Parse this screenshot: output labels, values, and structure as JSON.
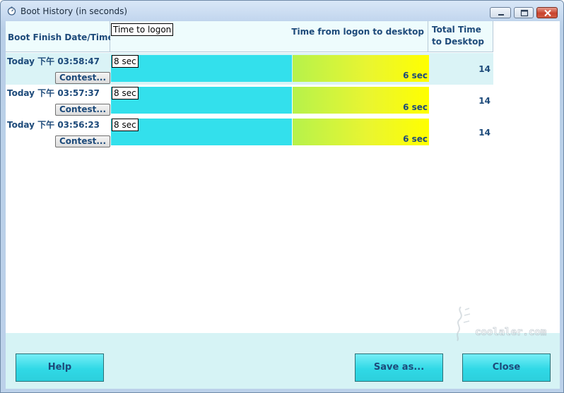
{
  "window": {
    "title": "Boot History (in seconds)"
  },
  "table": {
    "headers": {
      "date": "Boot Finish Date/Time",
      "logon": "Time to logon",
      "logon_to_desktop": "Time from logon to desktop",
      "total": "Total Time to Desktop"
    },
    "rows": [
      {
        "date": "Today  下午  03:58:47",
        "contest_label": "Contest...",
        "logon": "8 sec",
        "desktop": "6 sec",
        "total": "14",
        "selected": true
      },
      {
        "date": "Today  下午  03:57:37",
        "contest_label": "Contest...",
        "logon": "8 sec",
        "desktop": "6 sec",
        "total": "14",
        "selected": false
      },
      {
        "date": "Today  下午  03:56:23",
        "contest_label": "Contest...",
        "logon": "8 sec",
        "desktop": "6 sec",
        "total": "14",
        "selected": false
      }
    ]
  },
  "buttons": {
    "help": "Help",
    "save_as": "Save as...",
    "close": "Close"
  },
  "watermark": {
    "text": "coolaler.com"
  },
  "icons": {
    "app": "stopwatch-icon",
    "minimize": "minimize-icon",
    "maximize": "maximize-icon",
    "close": "close-icon"
  },
  "colors": {
    "logon_bar": "#33e0ec",
    "desktop_bar_start": "#b6f24b",
    "desktop_bar_end": "#ffff00",
    "button": "#30d9e6",
    "text": "#1d4a7a",
    "selected_row": "#daf3f6"
  }
}
